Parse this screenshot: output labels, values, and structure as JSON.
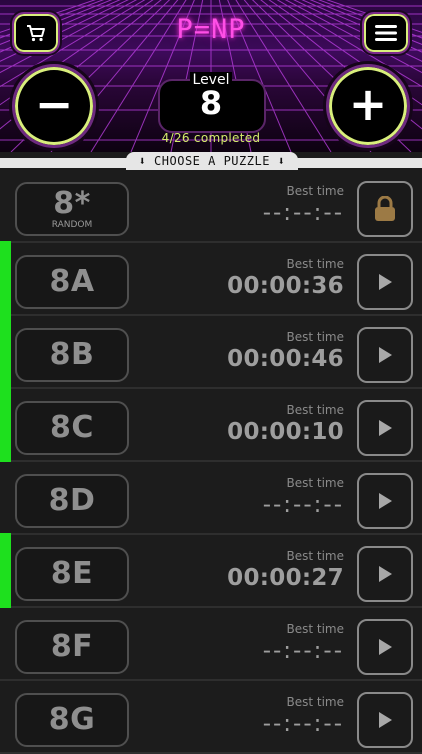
{
  "header": {
    "logo": "P=NP",
    "cart_icon": "cart-icon",
    "menu_icon": "hamburger-menu-icon",
    "level_label": "Level",
    "level_number": "8",
    "completed_text": "4/26 completed",
    "minus_label": "−",
    "plus_label": "+"
  },
  "choose_banner": "⬇ CHOOSE A PUZZLE ⬇",
  "colors": {
    "accent_green": "#1ee01e",
    "neon_pink": "#ff4fe6",
    "lime": "#d5ec6d"
  },
  "puzzles": [
    {
      "name": "8*",
      "sub": "RANDOM",
      "best_label": "Best time",
      "best_time": "--:--:--",
      "completed": false,
      "action_icon": "lock-icon"
    },
    {
      "name": "8A",
      "sub": "",
      "best_label": "Best time",
      "best_time": "00:00:36",
      "completed": true,
      "action_icon": "play-icon"
    },
    {
      "name": "8B",
      "sub": "",
      "best_label": "Best time",
      "best_time": "00:00:46",
      "completed": true,
      "action_icon": "play-icon"
    },
    {
      "name": "8C",
      "sub": "",
      "best_label": "Best time",
      "best_time": "00:00:10",
      "completed": true,
      "action_icon": "play-icon"
    },
    {
      "name": "8D",
      "sub": "",
      "best_label": "Best time",
      "best_time": "--:--:--",
      "completed": false,
      "action_icon": "play-icon"
    },
    {
      "name": "8E",
      "sub": "",
      "best_label": "Best time",
      "best_time": "00:00:27",
      "completed": true,
      "action_icon": "play-icon"
    },
    {
      "name": "8F",
      "sub": "",
      "best_label": "Best time",
      "best_time": "--:--:--",
      "completed": false,
      "action_icon": "play-icon"
    },
    {
      "name": "8G",
      "sub": "",
      "best_label": "Best time",
      "best_time": "--:--:--",
      "completed": false,
      "action_icon": "play-icon"
    }
  ]
}
